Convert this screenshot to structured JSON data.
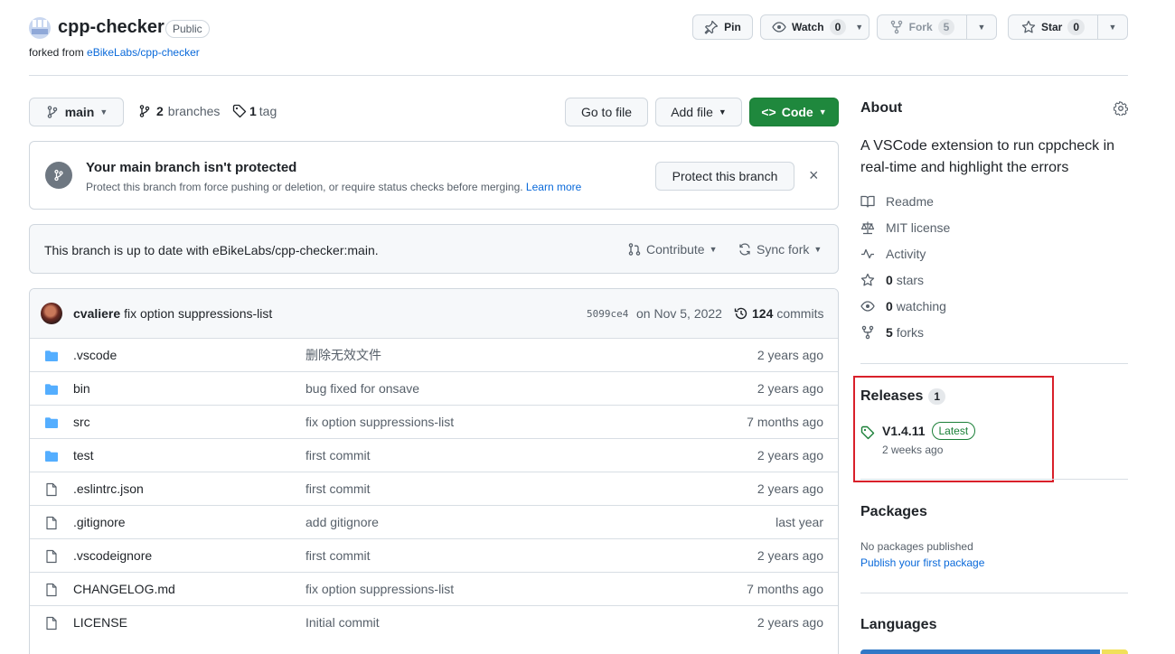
{
  "repo": {
    "name": "cpp-checker",
    "visibility": "Public",
    "forked_prefix": "forked from",
    "forked_source": "eBikeLabs/cpp-checker"
  },
  "header_actions": {
    "pin": "Pin",
    "watch": "Watch",
    "watch_count": "0",
    "fork": "Fork",
    "fork_count": "5",
    "star": "Star",
    "star_count": "0"
  },
  "toolbar": {
    "branch": "main",
    "branches_count": "2",
    "branches_label": "branches",
    "tags_count": "1",
    "tags_label": "tag",
    "go_to_file": "Go to file",
    "add_file": "Add file",
    "code": "Code"
  },
  "protect_banner": {
    "title": "Your main branch isn't protected",
    "description": "Protect this branch from force pushing or deletion, or require status checks before merging.",
    "learn_more": "Learn more",
    "button": "Protect this branch"
  },
  "sync": {
    "message": "This branch is up to date with eBikeLabs/cpp-checker:main.",
    "contribute": "Contribute",
    "sync_fork": "Sync fork"
  },
  "latest_commit": {
    "author": "cvaliere",
    "message": "fix option suppressions-list",
    "sha": "5099ce4",
    "date": "on Nov 5, 2022",
    "commits_count": "124",
    "commits_label": "commits"
  },
  "files": [
    {
      "type": "dir",
      "name": ".vscode",
      "message": "删除无效文件",
      "date": "2 years ago"
    },
    {
      "type": "dir",
      "name": "bin",
      "message": "bug fixed for onsave",
      "date": "2 years ago"
    },
    {
      "type": "dir",
      "name": "src",
      "message": "fix option suppressions-list",
      "date": "7 months ago"
    },
    {
      "type": "dir",
      "name": "test",
      "message": "first commit",
      "date": "2 years ago"
    },
    {
      "type": "file",
      "name": ".eslintrc.json",
      "message": "first commit",
      "date": "2 years ago"
    },
    {
      "type": "file",
      "name": ".gitignore",
      "message": "add gitignore",
      "date": "last year"
    },
    {
      "type": "file",
      "name": ".vscodeignore",
      "message": "first commit",
      "date": "2 years ago"
    },
    {
      "type": "file",
      "name": "CHANGELOG.md",
      "message": "fix option suppressions-list",
      "date": "7 months ago"
    },
    {
      "type": "file",
      "name": "LICENSE",
      "message": "Initial commit",
      "date": "2 years ago"
    }
  ],
  "about": {
    "heading": "About",
    "description": "A VSCode extension to run cppcheck in real-time and highlight the errors",
    "readme": "Readme",
    "license": "MIT license",
    "activity": "Activity",
    "stars_count": "0",
    "stars_label": "stars",
    "watching_count": "0",
    "watching_label": "watching",
    "forks_count": "5",
    "forks_label": "forks"
  },
  "releases": {
    "heading": "Releases",
    "count": "1",
    "version": "V1.4.11",
    "badge": "Latest",
    "date": "2 weeks ago"
  },
  "packages": {
    "heading": "Packages",
    "none": "No packages published",
    "publish_link": "Publish your first package"
  },
  "languages": {
    "heading": "Languages",
    "bar": [
      {
        "color": "#3178c6",
        "share": 0.9
      },
      {
        "color": "#f1e05a",
        "share": 0.1
      }
    ]
  },
  "colors": {
    "accent_link": "#0969da",
    "code_button": "#1f883d",
    "highlight_box": "#d9202a",
    "latest_badge": "#1a7f37"
  }
}
